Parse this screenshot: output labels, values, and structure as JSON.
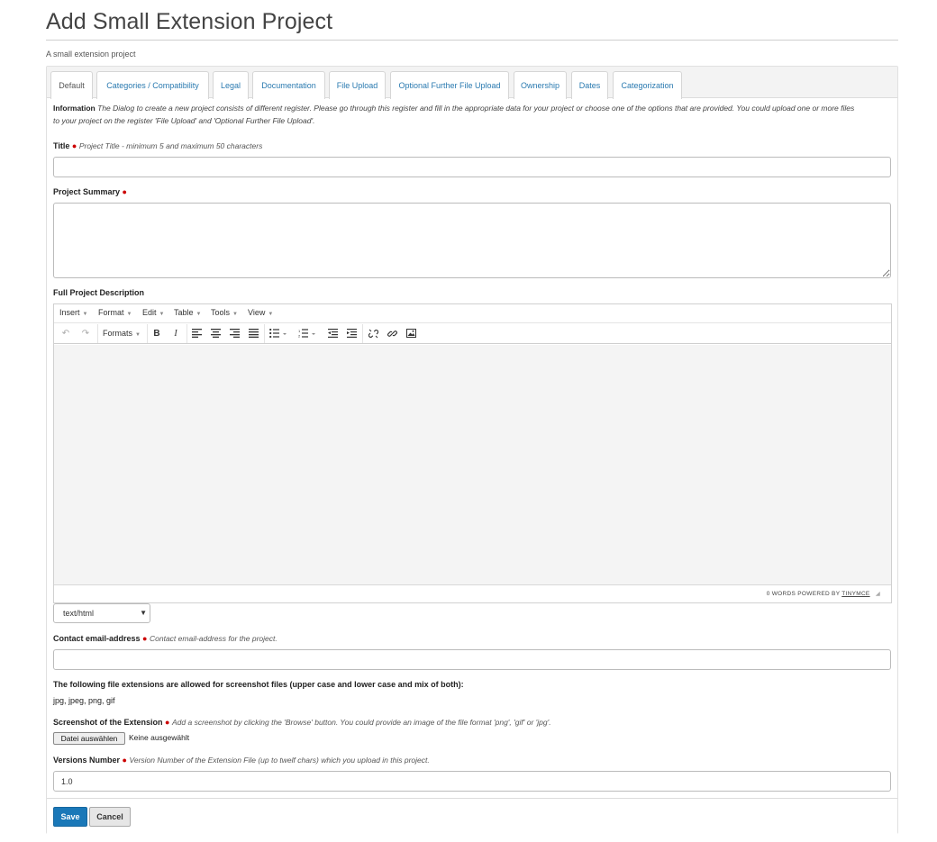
{
  "header": {
    "title": "Add Small Extension Project",
    "subtitle": "A small extension project"
  },
  "tabs": [
    {
      "label": "Default",
      "active": true
    },
    {
      "label": "Categories / Compatibility",
      "active": false
    },
    {
      "label": "Legal",
      "active": false
    },
    {
      "label": "Documentation",
      "active": false
    },
    {
      "label": "File Upload",
      "active": false
    },
    {
      "label": "Optional Further File Upload",
      "active": false
    },
    {
      "label": "Ownership",
      "active": false
    },
    {
      "label": "Dates",
      "active": false
    },
    {
      "label": "Categorization",
      "active": false
    }
  ],
  "info": {
    "label": "Information",
    "text": "The Dialog to create a new project consists of different register. Please go through this register and fill in the appropriate data for your project or choose one of the options that are provided. You could upload one or more files to your project on the register 'File Upload' and 'Optional Further File Upload'."
  },
  "form": {
    "required_mark": "●",
    "title": {
      "label": "Title",
      "hint": "Project Title - minimum 5 and maximum 50 characters",
      "value": ""
    },
    "summary": {
      "label": "Project Summary",
      "value": ""
    },
    "description": {
      "label": "Full Project Description"
    },
    "format_select": {
      "value": "text/html"
    },
    "contact": {
      "label": "Contact email-address",
      "hint": "Contact email-address for the project.",
      "value": ""
    },
    "extensions": {
      "label": "The following file extensions are allowed for screenshot files (upper case and lower case and mix of both):",
      "list": "jpg, jpeg, png, gif"
    },
    "screenshot": {
      "label": "Screenshot of the Extension",
      "hint": "Add a screenshot by clicking the 'Browse' button. You could provide an image of the file format 'png', 'gif' or 'jpg'.",
      "button": "Datei auswählen",
      "status": "Keine ausgewählt"
    },
    "version": {
      "label": "Versions Number",
      "hint": "Version Number of the Extension File (up to twelf chars) which you upload in this project.",
      "value": "1.0"
    }
  },
  "editor": {
    "menus": [
      "Insert",
      "Format",
      "Edit",
      "Table",
      "Tools",
      "View"
    ],
    "formats_label": "Formats",
    "status": {
      "words": "0 WORDS",
      "powered": "POWERED BY",
      "brand": "TINYMCE"
    }
  },
  "actions": {
    "save": "Save",
    "cancel": "Cancel"
  },
  "colors": {
    "accent": "#1a78b8",
    "link": "#2a7ab0",
    "required": "#cc0000"
  }
}
